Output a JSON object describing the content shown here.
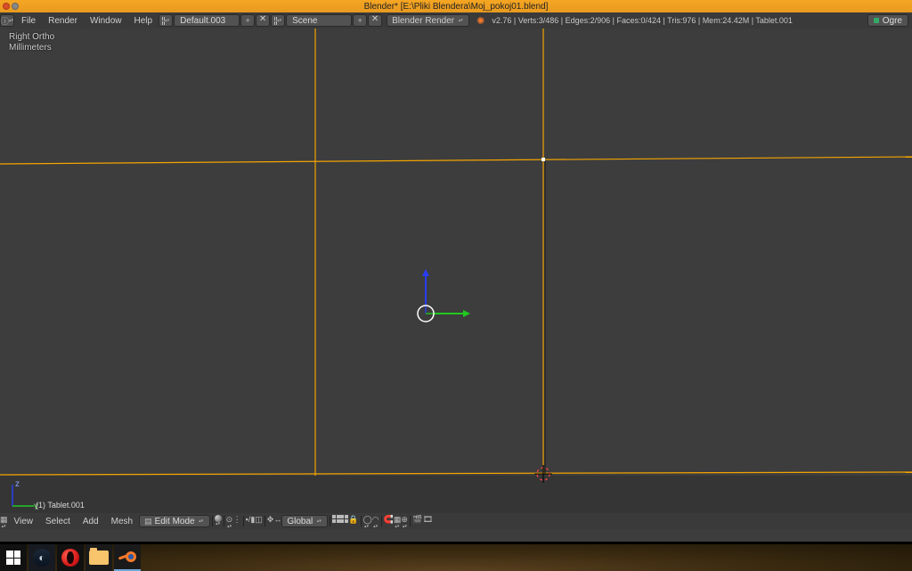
{
  "titlebar": {
    "title": "Blender* [E:\\Pliki Blendera\\Moj_pokoj01.blend]"
  },
  "topmenu": {
    "file": "File",
    "render": "Render",
    "window": "Window",
    "help": "Help"
  },
  "topfields": {
    "layout": "Default.003",
    "scene": "Scene",
    "engine": "Blender Render"
  },
  "stats": "v2.76 | Verts:3/486 | Edges:2/906 | Faces:0/424 | Tris:976 | Mem:24.42M | Tablet.001",
  "ogre": "Ogre",
  "viewport": {
    "label1": "Right Ortho",
    "label2": "Millimeters",
    "object": "(1) Tablet.001"
  },
  "vp_menu": {
    "view": "View",
    "select": "Select",
    "add": "Add",
    "mesh": "Mesh"
  },
  "vp_fields": {
    "mode": "Edit Mode",
    "orientation": "Global"
  },
  "colors": {
    "edge_selected": "#f4a400",
    "axis_z": "#2038ff",
    "axis_y": "#20c820",
    "axis_x": "#c82828"
  },
  "chart_data": null
}
